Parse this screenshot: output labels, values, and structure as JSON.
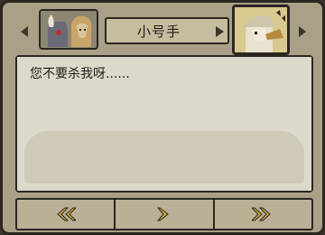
{
  "dialog": {
    "speaker": "小号手",
    "text": "您不要杀我呀......"
  },
  "portraits": {
    "left": "warrior-pair-icon",
    "right": "trumpeter-icon"
  },
  "controls": {
    "prev": "double-chevron-left-icon",
    "play": "chevron-right-icon",
    "fast_forward": "double-chevron-right-icon"
  },
  "colors": {
    "frame": "#aaa087",
    "panel": "#ddd9ca",
    "border": "#2b2620",
    "accent_gold": "#d6a73a"
  }
}
